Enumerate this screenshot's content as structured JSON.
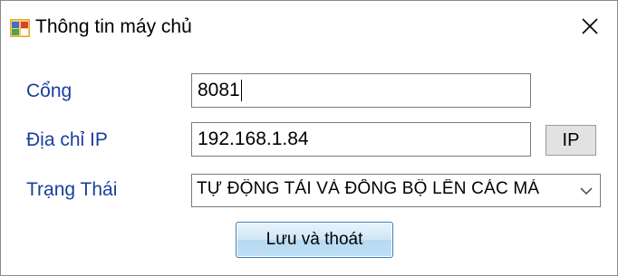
{
  "window": {
    "title": "Thông tin máy chủ",
    "icon": "app-window-icon",
    "close_icon": "close-icon"
  },
  "form": {
    "port": {
      "label": "Cổng",
      "value": "8081"
    },
    "ip": {
      "label": "Địa chỉ IP",
      "value": "192.168.1.84",
      "button_label": "IP"
    },
    "status": {
      "label": "Trạng Thái",
      "selected": "TỰ ĐỘNG TẢI VÀ ĐỒNG BỘ LÊN CÁC MÁ"
    },
    "save_label": "Lưu và thoát"
  },
  "colors": {
    "label_text": "#1b3f9e",
    "button_face": "#e2e2e2",
    "accent_button": "#bfe0f5"
  }
}
